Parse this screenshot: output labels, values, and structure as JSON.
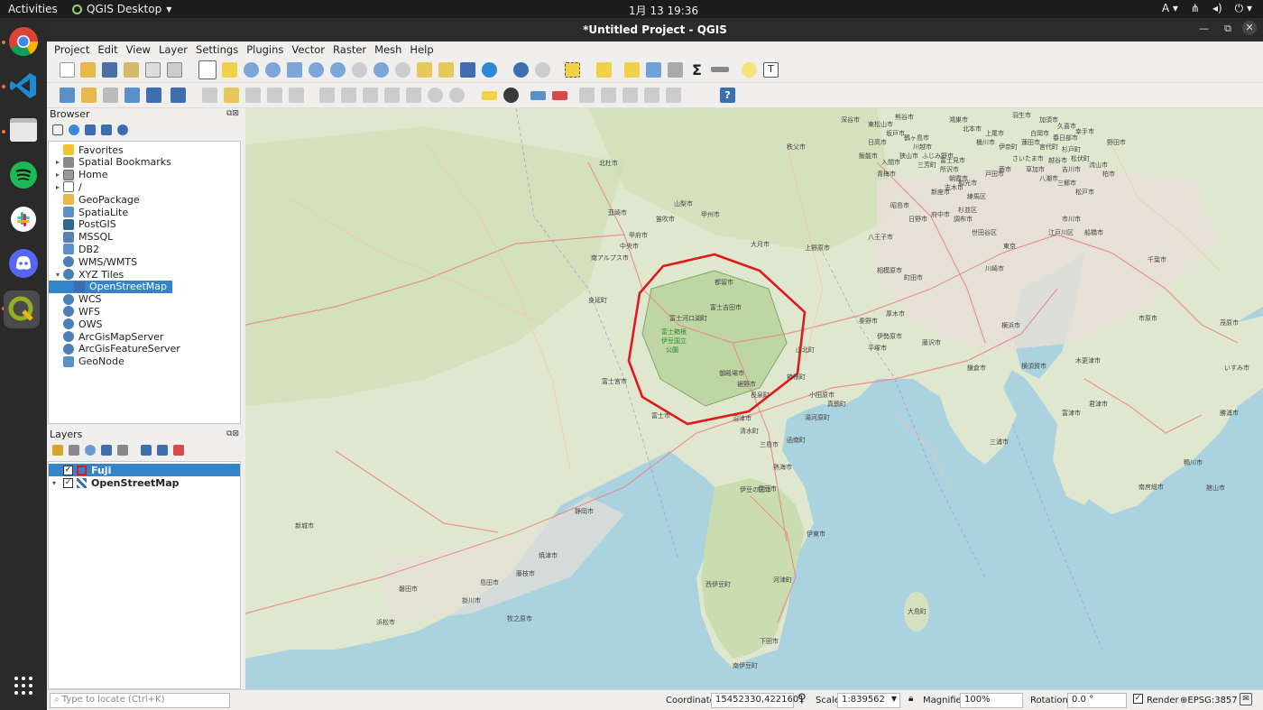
{
  "topbar": {
    "activities": "Activities",
    "app": "QGIS Desktop",
    "clock": "1月 13  19:36",
    "lang": "A"
  },
  "window": {
    "title": "*Untitled Project - QGIS"
  },
  "menu": [
    "Project",
    "Edit",
    "View",
    "Layer",
    "Settings",
    "Plugins",
    "Vector",
    "Raster",
    "Mesh",
    "Help"
  ],
  "browser": {
    "title": "Browser",
    "items": [
      {
        "label": "Favorites",
        "icon": "star-icon",
        "arrow": ""
      },
      {
        "label": "Spatial Bookmarks",
        "icon": "bookmark-icon",
        "arrow": "▸"
      },
      {
        "label": "Home",
        "icon": "home-folder-icon",
        "arrow": "▸"
      },
      {
        "label": "/",
        "icon": "folder-icon",
        "arrow": "▸"
      },
      {
        "label": "GeoPackage",
        "icon": "geopackage-icon",
        "arrow": ""
      },
      {
        "label": "SpatiaLite",
        "icon": "spatialite-icon",
        "arrow": ""
      },
      {
        "label": "PostGIS",
        "icon": "postgis-icon",
        "arrow": ""
      },
      {
        "label": "MSSQL",
        "icon": "mssql-icon",
        "arrow": ""
      },
      {
        "label": "DB2",
        "icon": "db2-icon",
        "arrow": ""
      },
      {
        "label": "WMS/WMTS",
        "icon": "globe-icon",
        "arrow": ""
      },
      {
        "label": "XYZ Tiles",
        "icon": "globe-icon",
        "arrow": "▾"
      },
      {
        "label": "OpenStreetMap",
        "icon": "xyz-tile-icon",
        "arrow": "",
        "indent": true,
        "selected": true
      },
      {
        "label": "WCS",
        "icon": "globe-icon",
        "arrow": ""
      },
      {
        "label": "WFS",
        "icon": "globe-icon",
        "arrow": ""
      },
      {
        "label": "OWS",
        "icon": "globe-icon",
        "arrow": ""
      },
      {
        "label": "ArcGisMapServer",
        "icon": "globe-icon",
        "arrow": ""
      },
      {
        "label": "ArcGisFeatureServer",
        "icon": "globe-icon",
        "arrow": ""
      },
      {
        "label": "GeoNode",
        "icon": "geonode-icon",
        "arrow": ""
      }
    ]
  },
  "layers": {
    "title": "Layers",
    "items": [
      {
        "label": "Fuji",
        "selected": true
      },
      {
        "label": "OpenStreetMap",
        "selected": false
      }
    ]
  },
  "map": {
    "labels": [
      "富士箱根伊豆国立公園",
      "富士吉田市",
      "大月市",
      "甲府市",
      "静岡市",
      "沼津市",
      "富士市",
      "御殿場市",
      "伊東市",
      "小田原市",
      "横浜市",
      "鎌倉市",
      "三浦市",
      "館山市",
      "八王子市",
      "相模原市",
      "町田市",
      "大島町",
      "下田市",
      "伊豆市",
      "熱海市",
      "浜松市",
      "新城市",
      "磐田市",
      "牧之原市",
      "焼津市",
      "藤枝市",
      "掛川市",
      "島田市",
      "富士宮市",
      "南アルプス市",
      "北杜市",
      "韮崎市",
      "上野原市",
      "厚木市",
      "平塚市",
      "藤沢市",
      "横須賀市",
      "木更津市",
      "君津市",
      "富津市",
      "鴨川市",
      "南房総市",
      "勝浦市",
      "いすみ市",
      "茂原市",
      "千葉市",
      "市原市",
      "東京",
      "川崎市",
      "さいたま市",
      "所沢市",
      "川越市",
      "青梅市",
      "秦野市",
      "伊勢原市",
      "南伊豆町",
      "河津町",
      "西伊豆町",
      "清水町",
      "長泉町",
      "裾野市",
      "三島市",
      "伊豆の国市",
      "函南町",
      "湯河原町",
      "真鶴町",
      "箱根町",
      "山北町",
      "都留市",
      "富士河口湖町",
      "身延町",
      "笛吹市",
      "山梨市",
      "甲州市",
      "中央市",
      "昭島市",
      "日野市",
      "府中市",
      "調布市",
      "世田谷区",
      "練馬区",
      "杉並区",
      "江戸川区",
      "船橋市",
      "市川市",
      "松戸市",
      "柏市",
      "流山市",
      "野田市",
      "越谷市",
      "春日部市",
      "上尾市",
      "鴻巣市",
      "熊谷市",
      "深谷市",
      "秩父市",
      "飯能市",
      "入間市",
      "狭山市",
      "日高市",
      "坂戸市",
      "鶴ヶ島市",
      "東松山市",
      "羽生市",
      "加須市",
      "久喜市",
      "幸手市",
      "八潮市",
      "三郷市",
      "吉川市",
      "草加市",
      "戸田市",
      "蕨市",
      "朝霞市",
      "志木市",
      "新座市",
      "和光市",
      "富士見市",
      "ふじみ野市",
      "三芳町",
      "桶川市",
      "北本市",
      "蓮田市",
      "白岡市",
      "伊奈町",
      "宮代町",
      "杉戸町",
      "松伏町"
    ],
    "accent": "#e0191c"
  },
  "status": {
    "locator_placeholder": "Type to locate (Ctrl+K)",
    "coordinate_label": "Coordinate",
    "coordinate": "15452330,4221601",
    "scale_label": "Scale",
    "scale": "1:839562",
    "magnifier_label": "Magnifier",
    "magnifier": "100%",
    "rotation_label": "Rotation",
    "rotation": "0.0 °",
    "render_label": "Render",
    "crs": "EPSG:3857"
  }
}
